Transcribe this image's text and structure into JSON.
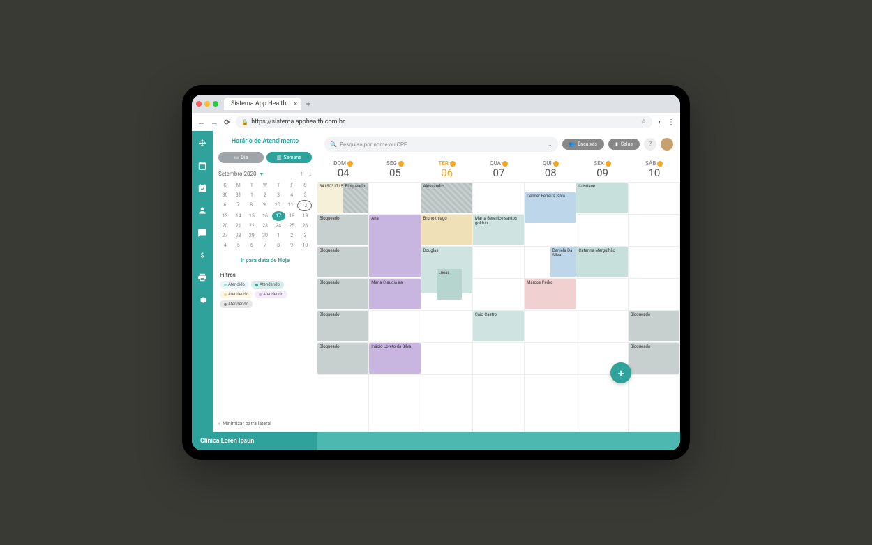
{
  "browser": {
    "tab_title": "Sistema App Health",
    "url": "https://sistema.apphealth.com.br"
  },
  "sidebar": {
    "title": "Horário de Atendimento",
    "view_day": "Dia",
    "view_week": "Semana",
    "month": "Setembro 2020",
    "dow": [
      "S",
      "M",
      "T",
      "W",
      "T",
      "F",
      "S"
    ],
    "weeks": [
      [
        "30",
        "31",
        "1",
        "2",
        "3",
        "4",
        "5"
      ],
      [
        "6",
        "7",
        "8",
        "9",
        "10",
        "11",
        "12"
      ],
      [
        "13",
        "14",
        "15",
        "16",
        "17",
        "18",
        "19"
      ],
      [
        "20",
        "21",
        "22",
        "23",
        "24",
        "25",
        "26"
      ],
      [
        "27",
        "28",
        "29",
        "30",
        "1",
        "2",
        "3"
      ],
      [
        "4",
        "5",
        "6",
        "7",
        "8",
        "9",
        "10"
      ]
    ],
    "today_cell": "17",
    "circle_cell": "12",
    "today_link": "Ir para data de Hoje",
    "filters_title": "Filtros",
    "filters": [
      {
        "label": "Atendido",
        "color": "#9ed7f0"
      },
      {
        "label": "Atendendo",
        "color": "#2ea29b"
      },
      {
        "label": "Atendendo",
        "color": "#f5d58a"
      },
      {
        "label": "Atendendo",
        "color": "#c8a6e0"
      },
      {
        "label": "Atendendo",
        "color": "#888888"
      }
    ],
    "minimize": "Minimizar barra lateral"
  },
  "topbar": {
    "search_placeholder": "Pesquisa por nome ou CPF",
    "encaixes": "Encaixes",
    "salas": "Salas"
  },
  "week": {
    "days": [
      {
        "name": "DOM",
        "num": "04"
      },
      {
        "name": "SEG",
        "num": "05"
      },
      {
        "name": "TER",
        "num": "06"
      },
      {
        "name": "QUA",
        "num": "07"
      },
      {
        "name": "QUI",
        "num": "08"
      },
      {
        "name": "SEX",
        "num": "09"
      },
      {
        "name": "SÁB",
        "num": "10"
      }
    ],
    "today_index": 2
  },
  "events": {
    "dom": [
      {
        "row": 0,
        "h": 1,
        "text": "3415031715",
        "color": "#f7f0d8",
        "w": 0.5,
        "x": 0
      },
      {
        "row": 0,
        "h": 1,
        "text": "Bloqueado",
        "color": "#c7cfcf",
        "hatch": true,
        "w": 0.5,
        "x": 0.5
      },
      {
        "row": 1,
        "h": 1,
        "text": "Bloqueado",
        "color": "#c7cfcf"
      },
      {
        "row": 2,
        "h": 1,
        "text": "Bloqueado",
        "color": "#c7cfcf"
      },
      {
        "row": 3,
        "h": 1,
        "text": "Bloqueado",
        "color": "#c7cfcf"
      },
      {
        "row": 4,
        "h": 1,
        "text": "Bloqueado",
        "color": "#c7cfcf"
      },
      {
        "row": 5,
        "h": 1,
        "text": "Bloqueado",
        "color": "#c7cfcf"
      }
    ],
    "seg": [
      {
        "row": 1,
        "h": 2,
        "text": "Ana",
        "color": "#c8b6e0"
      },
      {
        "row": 3,
        "h": 1,
        "text": "Maria Claudia aa",
        "color": "#c8b6e0"
      },
      {
        "row": 5,
        "h": 1,
        "text": "Inácio Loreto da Silva",
        "color": "#c8b6e0"
      }
    ],
    "ter": [
      {
        "row": 0,
        "h": 1,
        "text": "Alessandro",
        "color": "#c7cfcf",
        "hatch": true
      },
      {
        "row": 1,
        "h": 1,
        "text": "Bruno thiago",
        "color": "#f0e0b8"
      },
      {
        "row": 2,
        "h": 1.5,
        "text": "Douglas",
        "color": "#cfe4e0"
      },
      {
        "row": 2.7,
        "h": 1,
        "text": "Lucas",
        "color": "#b7d5cf",
        "w": 0.5,
        "x": 0.3
      }
    ],
    "qua": [
      {
        "row": 1,
        "h": 1,
        "text": "Marta Berenice santos goldrin",
        "color": "#cfe4e0"
      },
      {
        "row": 4,
        "h": 1,
        "text": "Caio Castro",
        "color": "#cfe4e0"
      }
    ],
    "qui": [
      {
        "row": 0,
        "h": 1,
        "text": "Denner Ferreira Silva",
        "color": "#bdd6ea",
        "y": 0.3
      },
      {
        "row": 2,
        "h": 1,
        "text": "Daniela Da Silva",
        "color": "#bdd6ea",
        "w": 0.5,
        "x": 0.5
      },
      {
        "row": 3,
        "h": 1,
        "text": "Marcos Pedro",
        "color": "#f0d0d0"
      }
    ],
    "sex": [
      {
        "row": 0,
        "h": 1,
        "text": "Cristiane",
        "color": "#c8e0dc"
      },
      {
        "row": 2,
        "h": 1,
        "text": "Catarina Mergulhão",
        "color": "#c8e0dc"
      }
    ],
    "sab": [
      {
        "row": 4,
        "h": 1,
        "text": "Bloqueado",
        "color": "#c7cfcf"
      },
      {
        "row": 5,
        "h": 1,
        "text": "Bloqueado",
        "color": "#c7cfcf"
      }
    ]
  },
  "footer": {
    "clinic": "Clínica Loren Ipsun"
  }
}
